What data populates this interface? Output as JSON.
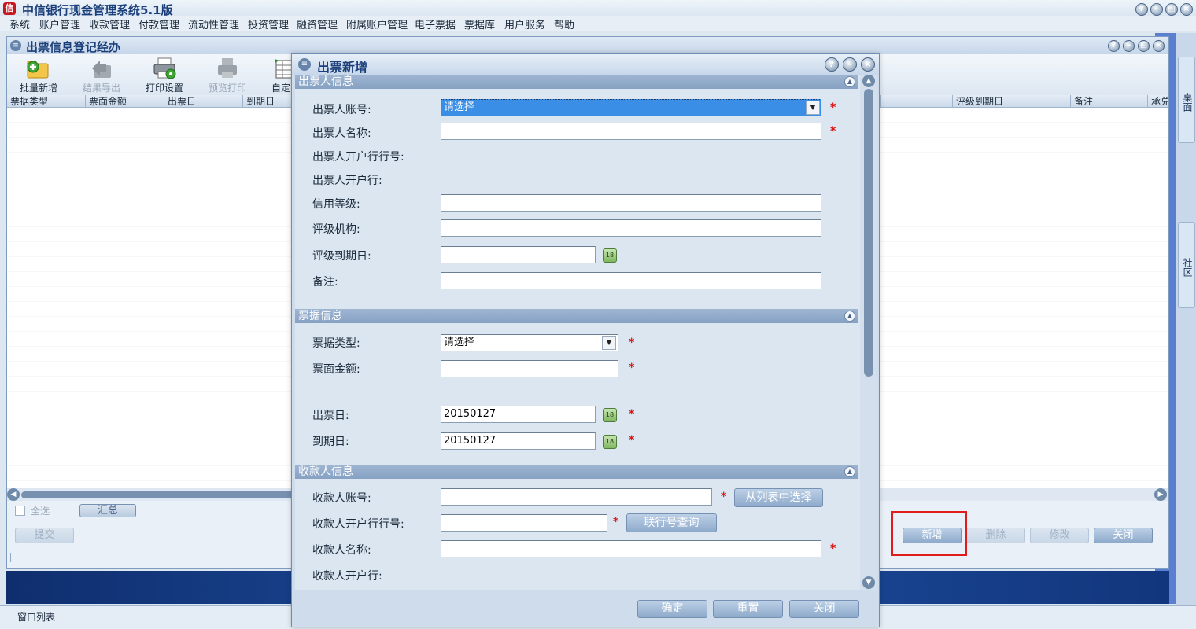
{
  "app": {
    "title": "中信银行现金管理系统5.1版",
    "logo_text": "信"
  },
  "window_controls": {
    "help": "?",
    "minimize": "–",
    "maximize": "□",
    "close": "×"
  },
  "menu": [
    "系统",
    "账户管理",
    "收款管理",
    "付款管理",
    "流动性管理",
    "投资管理",
    "融资管理",
    "附属账户管理",
    "电子票据",
    "票据库",
    "用户服务",
    "帮助"
  ],
  "right_dock": {
    "tab1": "桌面",
    "tab2": "社区"
  },
  "taskbar": {
    "window_list": "窗口列表"
  },
  "bg_window": {
    "title": "出票信息登记经办",
    "toolbar": [
      {
        "label": "批量新增",
        "icon": "folder-add-icon",
        "enabled": true
      },
      {
        "label": "结果导出",
        "icon": "export-icon",
        "enabled": false
      },
      {
        "label": "打印设置",
        "icon": "printer-settings-icon",
        "enabled": true
      },
      {
        "label": "预览打印",
        "icon": "print-preview-icon",
        "enabled": false
      },
      {
        "label": "自定",
        "icon": "custom-columns-icon",
        "enabled": true
      }
    ],
    "columns_left": [
      "票据类型",
      "票面金额",
      "出票日",
      "到期日"
    ],
    "columns_right": [
      "评级到期日",
      "备注",
      "承兑"
    ],
    "select_all": "全选",
    "summary_button": "汇总",
    "submit_button": "提交",
    "actions": {
      "add": "新增",
      "delete": "删除",
      "modify": "修改",
      "close": "关闭"
    }
  },
  "dialog": {
    "title": "出票新增",
    "sections": {
      "drawer": "出票人信息",
      "bill": "票据信息",
      "payee": "收款人信息"
    },
    "drawer": {
      "account_label": "出票人账号:",
      "account_value": "请选择",
      "name_label": "出票人名称:",
      "bank_no_label": "出票人开户行行号:",
      "bank_label": "出票人开户行:",
      "credit_label": "信用等级:",
      "rating_org_label": "评级机构:",
      "rating_expiry_label": "评级到期日:",
      "remark_label": "备注:"
    },
    "bill": {
      "type_label": "票据类型:",
      "type_value": "请选择",
      "amount_label": "票面金额:",
      "issue_date_label": "出票日:",
      "issue_date_value": "20150127",
      "due_date_label": "到期日:",
      "due_date_value": "20150127"
    },
    "payee": {
      "account_label": "收款人账号:",
      "select_from_list": "从列表中选择",
      "bank_no_label": "收款人开户行行号:",
      "bank_no_query": "联行号查询",
      "name_label": "收款人名称:",
      "bank_label": "收款人开户行:"
    },
    "required_mark": "*",
    "calendar_text": "18",
    "footer": {
      "confirm": "确定",
      "reset": "重置",
      "close": "关闭"
    }
  }
}
